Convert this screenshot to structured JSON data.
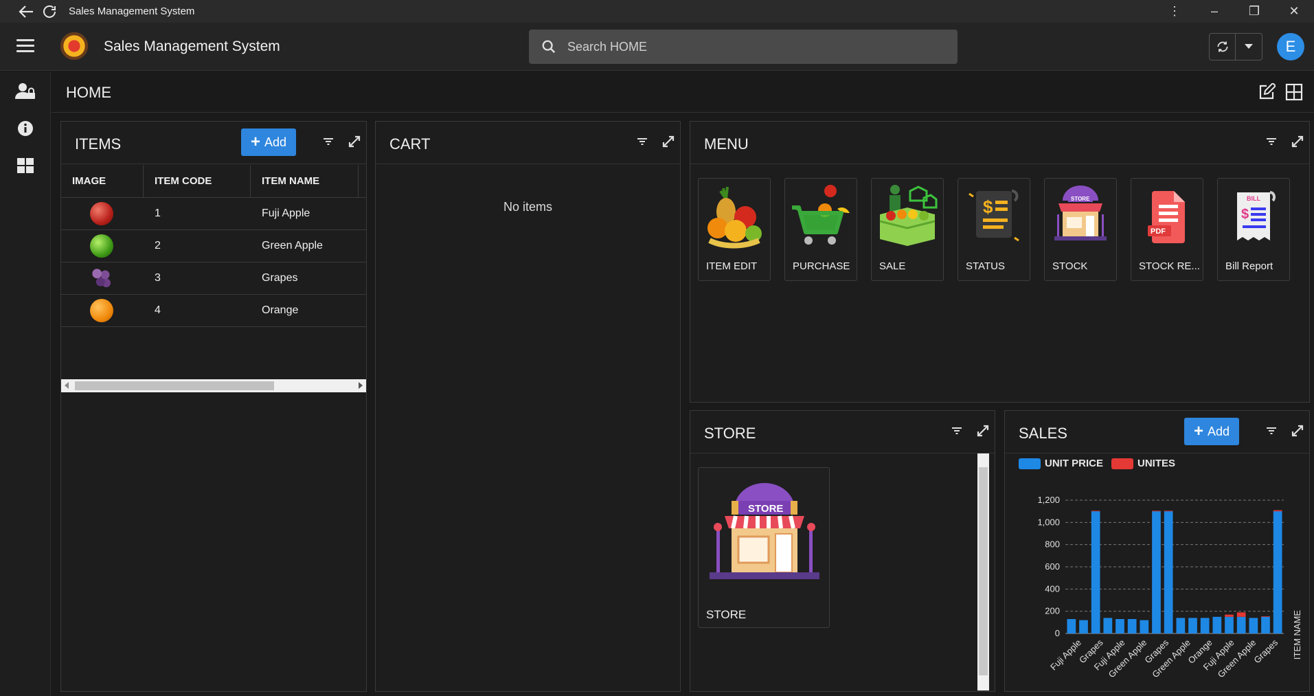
{
  "window": {
    "title": "Sales Management System"
  },
  "app": {
    "title": "Sales Management System",
    "avatar_initial": "E"
  },
  "search": {
    "placeholder": "Search HOME"
  },
  "page": {
    "title": "HOME"
  },
  "items_panel": {
    "title": "ITEMS",
    "add_label": "Add",
    "columns": [
      "IMAGE",
      "ITEM CODE",
      "ITEM NAME"
    ],
    "rows": [
      {
        "code": "1",
        "name": "Fuji Apple",
        "fruit": "apple-red"
      },
      {
        "code": "2",
        "name": "Green Apple",
        "fruit": "apple-green"
      },
      {
        "code": "3",
        "name": "Grapes",
        "fruit": "grapes"
      },
      {
        "code": "4",
        "name": "Orange",
        "fruit": "orange"
      }
    ]
  },
  "cart_panel": {
    "title": "CART",
    "empty_text": "No items"
  },
  "menu_panel": {
    "title": "MENU",
    "tiles": [
      {
        "label": "ITEM EDIT",
        "icon": "fruit-basket-icon"
      },
      {
        "label": "PURCHASE",
        "icon": "shopping-cart-icon"
      },
      {
        "label": "SALE",
        "icon": "produce-stand-icon"
      },
      {
        "label": "STATUS",
        "icon": "receipt-icon"
      },
      {
        "label": "STOCK",
        "icon": "store-icon"
      },
      {
        "label": "STOCK RE...",
        "icon": "pdf-report-icon"
      },
      {
        "label": "Bill Report",
        "icon": "bill-icon"
      }
    ]
  },
  "store_panel": {
    "title": "STORE",
    "tile_label": "STORE",
    "tile_sign": "STORE"
  },
  "sales_panel": {
    "title": "SALES",
    "add_label": "Add"
  },
  "colors": {
    "accent": "#2e86de",
    "unit_price": "#1e88e5",
    "unites": "#e53935"
  },
  "chart_data": {
    "type": "bar",
    "stacked": true,
    "legend": [
      "UNIT PRICE",
      "UNITES"
    ],
    "legend_position": "top-left",
    "ylabel": "",
    "xlabel": "ITEM NAME",
    "ylim": [
      0,
      1200
    ],
    "yticks": [
      "0",
      "200",
      "400",
      "600",
      "800",
      "1,000",
      "1,200"
    ],
    "grid": true,
    "xtick_labels": [
      "Fuji Apple",
      "Grapes",
      "Fuji Apple",
      "Green Apple",
      "Grapes",
      "Green Apple",
      "Orange",
      "Fuji Apple",
      "Green Apple",
      "Grapes"
    ],
    "series": [
      {
        "name": "UNIT PRICE",
        "values": [
          130,
          120,
          1100,
          140,
          130,
          130,
          120,
          1100,
          1100,
          140,
          140,
          140,
          150,
          150,
          150,
          140,
          150,
          1100
        ]
      },
      {
        "name": "UNITES",
        "values": [
          0,
          0,
          5,
          0,
          0,
          0,
          0,
          5,
          5,
          0,
          0,
          0,
          0,
          20,
          40,
          0,
          5,
          10
        ]
      }
    ]
  }
}
